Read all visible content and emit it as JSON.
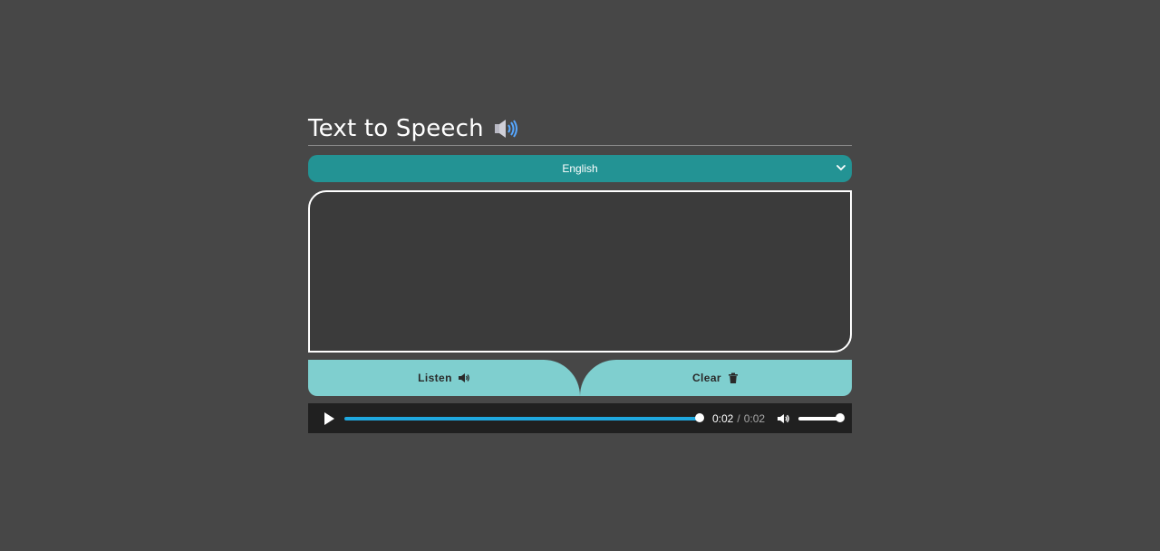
{
  "header": {
    "title": "Text to Speech",
    "icon": "speaker-loud-icon"
  },
  "language_select": {
    "selected": "English",
    "icon": "chevron-down-icon",
    "accent": "#239394"
  },
  "textarea": {
    "value": "",
    "placeholder": ""
  },
  "actions": {
    "listen_label": "Listen",
    "listen_icon": "speaker-icon",
    "clear_label": "Clear",
    "clear_icon": "trash-icon",
    "button_color": "#7fcfcf"
  },
  "audio_player": {
    "current_time": "0:02",
    "separator": "/",
    "duration": "0:02",
    "progress": 1.0,
    "volume": 1.0,
    "progress_color": "#1fa8df",
    "play_icon": "play-icon",
    "volume_icon": "volume-icon"
  }
}
